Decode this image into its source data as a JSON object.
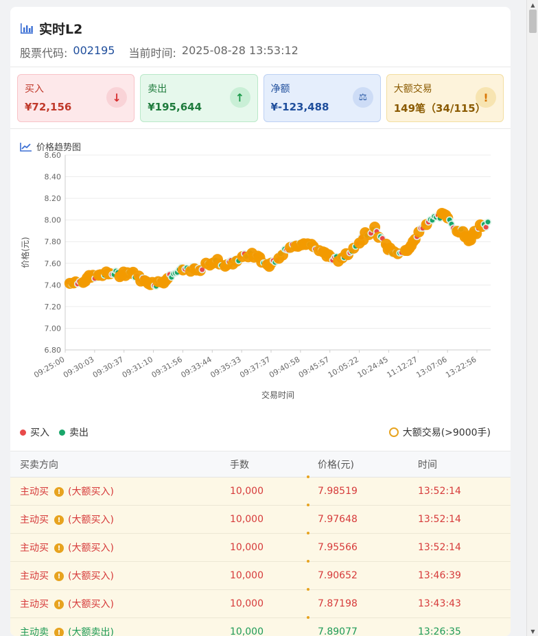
{
  "header": {
    "title": "实时L2",
    "stock_code_label": "股票代码:",
    "stock_code": "002195",
    "current_time_label": "当前时间:",
    "current_time": "2025-08-28 13:53:12"
  },
  "stats": {
    "buy": {
      "label": "买入",
      "value": "¥72,156",
      "icon": "arrow-down-icon"
    },
    "sell": {
      "label": "卖出",
      "value": "¥195,644",
      "icon": "arrow-up-icon"
    },
    "net": {
      "label": "净额",
      "value": "¥-123,488",
      "icon": "scale-icon"
    },
    "big": {
      "label": "大额交易",
      "value": "149笔（34/115）",
      "icon": "alert-icon"
    }
  },
  "chart_section": {
    "title": "价格趋势图",
    "legend_buy": "买入",
    "legend_sell": "卖出",
    "legend_big": "大额交易(>9000手)"
  },
  "colors": {
    "buy": "#e84a4a",
    "sell": "#19a66a",
    "big": "#f29a00",
    "accent": "#1f4e9c"
  },
  "chart_data": {
    "type": "scatter",
    "xlabel": "交易时间",
    "ylabel": "价格(元)",
    "ylim": [
      6.8,
      8.6
    ],
    "yticks": [
      "6.80",
      "7.00",
      "7.20",
      "7.40",
      "7.60",
      "7.80",
      "8.00",
      "8.20",
      "8.40",
      "8.60"
    ],
    "xticks": [
      "09:25:00",
      "09:30:03",
      "09:30:37",
      "09:31:10",
      "09:31:56",
      "09:33:44",
      "09:35:33",
      "09:37:37",
      "09:40:58",
      "09:45:57",
      "10:05:22",
      "10:24:45",
      "11:12:27",
      "13:07:06",
      "13:22:56"
    ],
    "grid": true,
    "legend_position": "bottom",
    "trend": [
      7.43,
      7.42,
      7.45,
      7.48,
      7.49,
      7.51,
      7.5,
      7.52,
      7.47,
      7.43,
      7.41,
      7.44,
      7.5,
      7.54,
      7.55,
      7.53,
      7.6,
      7.62,
      7.58,
      7.62,
      7.66,
      7.69,
      7.63,
      7.58,
      7.66,
      7.72,
      7.77,
      7.8,
      7.76,
      7.7,
      7.66,
      7.63,
      7.7,
      7.78,
      7.86,
      7.92,
      7.8,
      7.7,
      7.68,
      7.75,
      7.88,
      7.96,
      8.03,
      8.04,
      7.95,
      7.89,
      7.82,
      7.93,
      7.96
    ]
  },
  "table": {
    "headers": [
      "买卖方向",
      "手数",
      "价格(元)",
      "时间"
    ],
    "rows": [
      {
        "direction": "主动买",
        "tag": "(大额买入)",
        "lots": "10,000",
        "price": "7.98519",
        "time": "13:52:14",
        "side": "buy"
      },
      {
        "direction": "主动买",
        "tag": "(大额买入)",
        "lots": "10,000",
        "price": "7.97648",
        "time": "13:52:14",
        "side": "buy"
      },
      {
        "direction": "主动买",
        "tag": "(大额买入)",
        "lots": "10,000",
        "price": "7.95566",
        "time": "13:52:14",
        "side": "buy"
      },
      {
        "direction": "主动买",
        "tag": "(大额买入)",
        "lots": "10,000",
        "price": "7.90652",
        "time": "13:46:39",
        "side": "buy"
      },
      {
        "direction": "主动买",
        "tag": "(大额买入)",
        "lots": "10,000",
        "price": "7.87198",
        "time": "13:43:43",
        "side": "buy"
      },
      {
        "direction": "主动卖",
        "tag": "(大额卖出)",
        "lots": "10,000",
        "price": "7.89077",
        "time": "13:26:35",
        "side": "sell"
      }
    ]
  }
}
